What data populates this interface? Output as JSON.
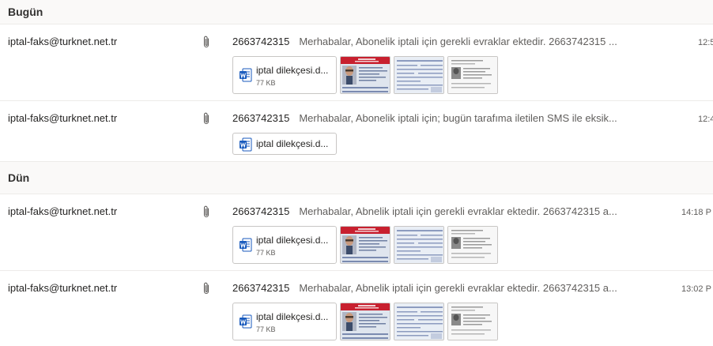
{
  "groups": [
    {
      "label": "Bugün"
    },
    {
      "label": "Dün"
    }
  ],
  "messages": [
    {
      "sender": "iptal-faks@turknet.net.tr",
      "subject": "2663742315",
      "preview": "Merhabalar, Abonelik iptali için gerekli evraklar ektedir. 2663742315 ...",
      "time": "12:5",
      "attachment": {
        "name": "iptal dilekçesi.d...",
        "size": "77 KB"
      }
    },
    {
      "sender": "iptal-faks@turknet.net.tr",
      "subject": "2663742315",
      "preview": "Merhabalar, Abonelik iptali için; bugün tarafıma iletilen SMS ile eksik...",
      "time": "12:4",
      "attachment": {
        "name": "iptal dilekçesi.d..."
      }
    },
    {
      "sender": "iptal-faks@turknet.net.tr",
      "subject": "2663742315",
      "preview": "Merhabalar, Abnelik iptali için gerekli evraklar ektedir. 2663742315 a...",
      "time": "14:18 P",
      "attachment": {
        "name": "iptal dilekçesi.d...",
        "size": "77 KB"
      }
    },
    {
      "sender": "iptal-faks@turknet.net.tr",
      "subject": "2663742315",
      "preview": "Merhabalar, Abnelik iptali için gerekli evraklar ektedir. 2663742315 a...",
      "time": "13:02 P",
      "attachment": {
        "name": "iptal dilekçesi.d...",
        "size": "77 KB"
      }
    }
  ],
  "icons": {
    "attachment": "paperclip-icon",
    "document": "word-document-icon"
  },
  "colors": {
    "word_blue": "#185abd",
    "id_card_red": "#c8202f",
    "group_bg": "#faf9f8"
  }
}
